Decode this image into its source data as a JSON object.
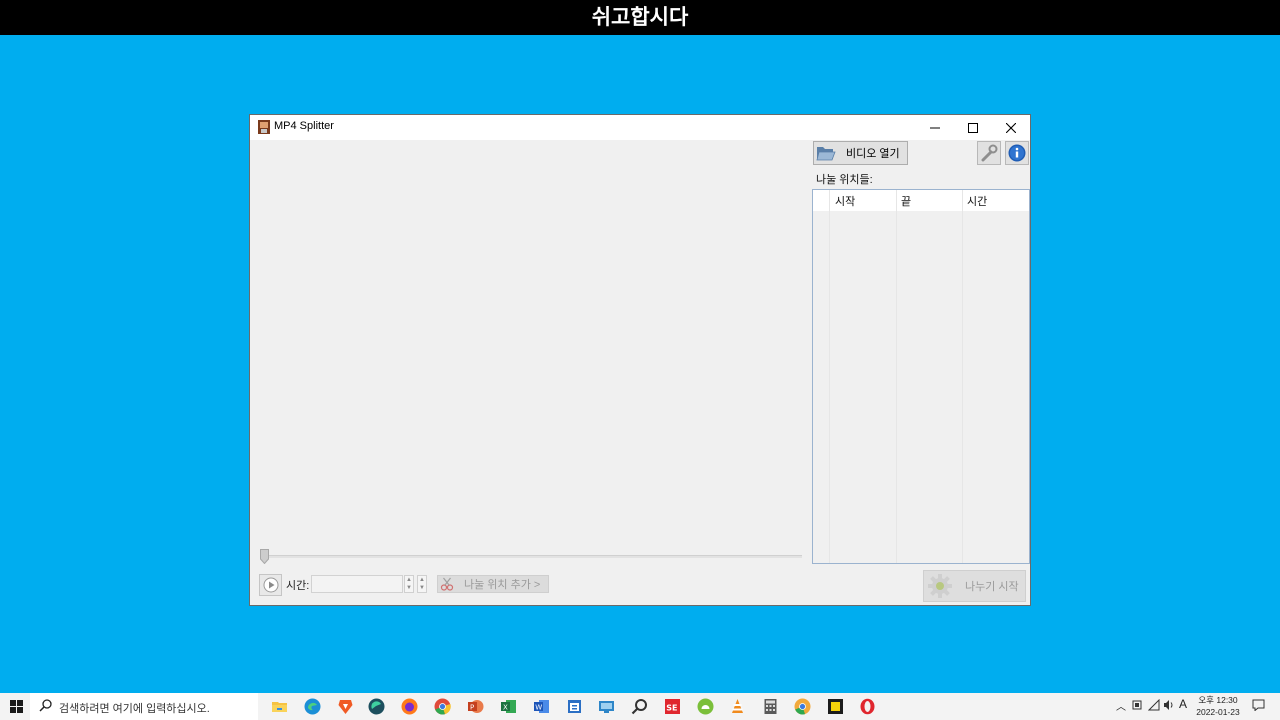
{
  "banner": {
    "text": "쉬고합시다"
  },
  "window": {
    "title": "MP4 Splitter",
    "time_label": "시간:",
    "time_value": "",
    "add_split_label": "나눌 위치 추가 >",
    "open_video_label": "비디오 열기",
    "split_positions_label": "나눌 위치들:",
    "columns": [
      "시작",
      "끝",
      "시간"
    ],
    "start_split_label": "나누기 시작"
  },
  "taskbar": {
    "search_placeholder": "검색하려면 여기에 입력하십시오.",
    "apps": [
      "file-explorer",
      "edge",
      "brave",
      "edge-dev",
      "firefox",
      "chrome",
      "powerpoint",
      "excel",
      "word",
      "calendar-app",
      "remote-desktop",
      "search-tool",
      "se-app",
      "android-app",
      "vlc",
      "calculator",
      "chrome-canary",
      "sticky-app",
      "opera"
    ],
    "ime_label": "A",
    "clock_time": "오후 12:30",
    "clock_date": "2022-01-23"
  }
}
